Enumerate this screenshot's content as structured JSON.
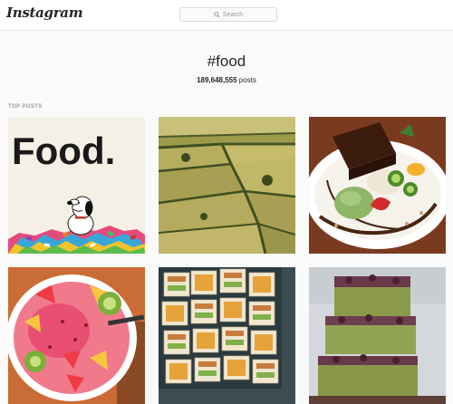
{
  "header": {
    "logo": "Instagram",
    "search_placeholder": "Search",
    "search_icon": "search-icon"
  },
  "hashtag": {
    "title": "#food",
    "count": "189,648,555",
    "count_suffix": " posts"
  },
  "sections": {
    "top_posts_label": "TOP POSTS"
  },
  "posts": [
    {
      "image_text": "Food."
    },
    {
      "image_text": ""
    },
    {
      "image_text": ""
    },
    {
      "image_text": ""
    },
    {
      "image_text": ""
    },
    {
      "image_text": ""
    }
  ],
  "colors": {
    "background": "#fafafa",
    "border": "#dbdbdb",
    "text": "#262626",
    "muted": "#999999"
  }
}
